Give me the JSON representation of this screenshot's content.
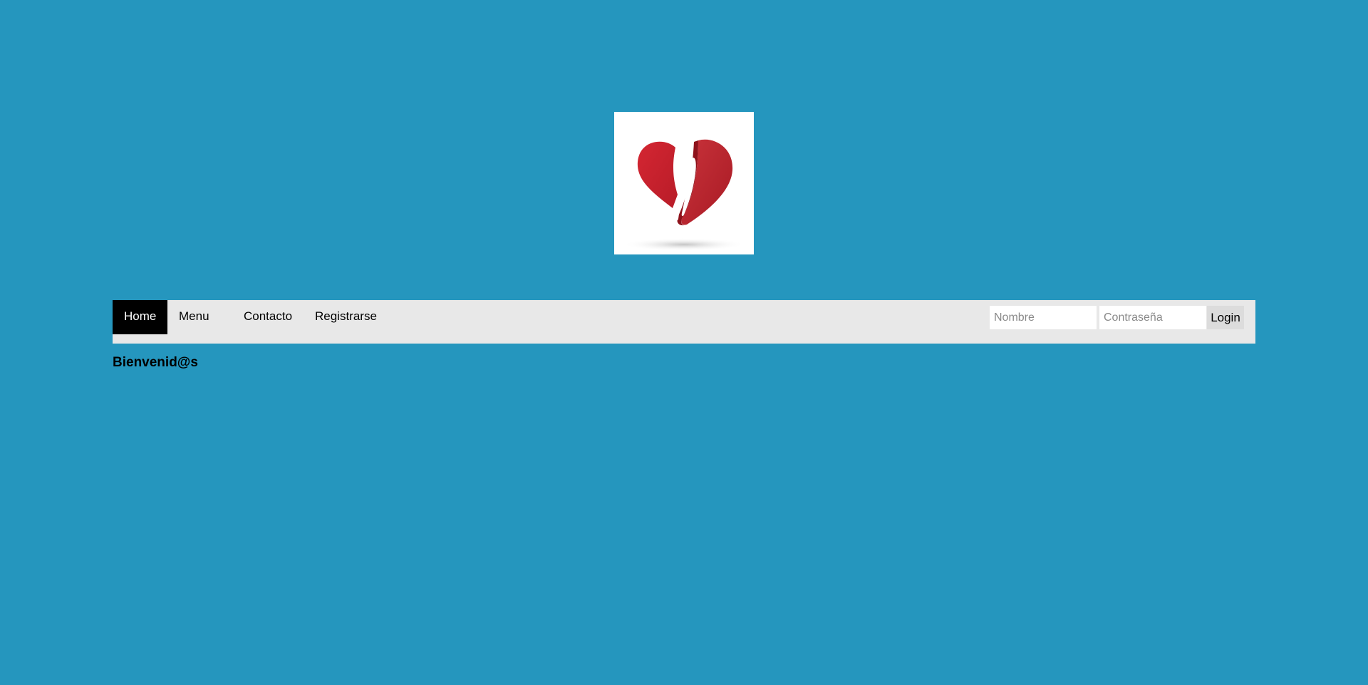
{
  "logo": {
    "icon": "heart-fork-knife-logo"
  },
  "nav": {
    "items": [
      {
        "label": "Home",
        "active": true
      },
      {
        "label": "Menu",
        "active": false
      },
      {
        "label": "Contacto",
        "active": false
      },
      {
        "label": "Registrarse",
        "active": false
      }
    ]
  },
  "login": {
    "name_placeholder": "Nombre",
    "name_value": "",
    "password_placeholder": "Contraseña",
    "password_value": "",
    "button_label": "Login"
  },
  "main": {
    "welcome": "Bienvenid@s"
  },
  "colors": {
    "background": "#2596be",
    "navbar": "#e8e8e8",
    "active_tab": "#000000",
    "logo_red": "#c8202e"
  }
}
